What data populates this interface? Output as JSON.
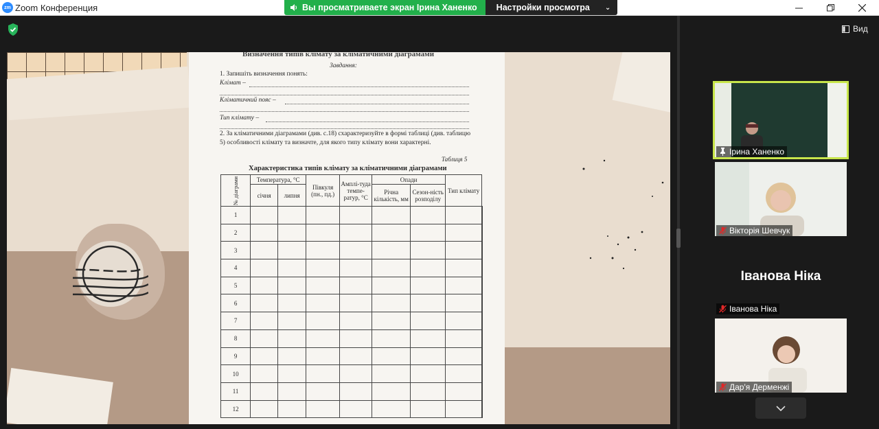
{
  "window": {
    "app_badge": "zm",
    "title": "Zoom Конференция"
  },
  "share_banner": {
    "viewing_text": "Вы просматриваете экран Ірина Ханенко",
    "view_settings_label": "Настройки просмотра"
  },
  "toolbar": {
    "view_label": "Вид"
  },
  "worksheet": {
    "title": "Визначення типів клімату за кліматичними діаграмами",
    "task_heading": "Завдання:",
    "task1": "1. Запишіть визначення понять:",
    "term1": "Клімат –",
    "term2": "Кліматичний пояс –",
    "term3": "Тип клімату –",
    "task2": "2. За кліматичними діаграмами (див. с.18) схарактеризуйте в формі таблиці (див. таблицю 5) особливості клімату та визначте, для якого типу клімату вони характерні.",
    "table_label": "Таблиця 5",
    "table_caption": "Характеристика типів клімату за кліматичними діаграмами",
    "headers": {
      "num": "№ діаграми",
      "temperature": "Температура, °С",
      "january": "січня",
      "july": "липня",
      "hemisphere": "Півкуля (пн., пд.)",
      "amplitude": "Амплі-туда темпе-ратур, °С",
      "precip": "Опади",
      "annual": "Річна кількість, мм",
      "seasonal": "Сезон-ність розподілу",
      "climate_type": "Тип клімату"
    },
    "rows": [
      "1",
      "2",
      "3",
      "4",
      "5",
      "6",
      "7",
      "8",
      "9",
      "10",
      "11",
      "12"
    ]
  },
  "participants": [
    {
      "name": "Ірина Ханенко",
      "status_icon": "pin-icon",
      "active_speaker": true
    },
    {
      "name": "Вікторія Шевчук",
      "status_icon": "mic-off-icon"
    },
    {
      "name": "Іванова Ніка",
      "status_icon": "mic-off-icon",
      "no_video_label": "Іванова Ніка"
    },
    {
      "name": "Дар'я Дерменжі",
      "status_icon": "mic-off-icon"
    }
  ],
  "colors": {
    "share_green": "#22b04b",
    "active_speaker_border": "#c8e64b",
    "mic_off_red": "#e02828"
  }
}
